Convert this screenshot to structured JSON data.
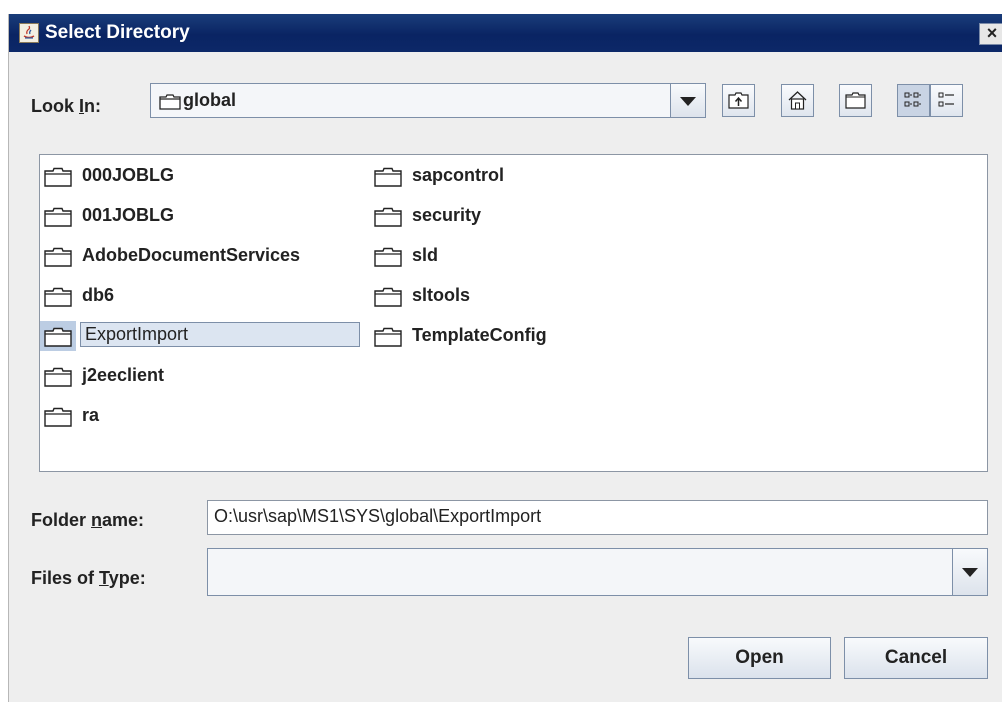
{
  "window": {
    "title": "Select Directory",
    "close_glyph": "×"
  },
  "look_in": {
    "label_pre": "Look ",
    "label_mnemonic": "I",
    "label_post": "n:",
    "value": "global"
  },
  "toolbar": {
    "buttons": [
      "up-one-level-icon",
      "home-icon",
      "new-folder-icon",
      "list-view-icon",
      "details-view-icon"
    ]
  },
  "files": {
    "column1": [
      "000JOBLG",
      "001JOBLG",
      "AdobeDocumentServices",
      "db6",
      "ExportImport",
      "j2eeclient",
      "ra"
    ],
    "column2": [
      "sapcontrol",
      "security",
      "sld",
      "sltools",
      "TemplateConfig"
    ],
    "selected": "ExportImport"
  },
  "folder_name": {
    "label_pre": "Folder ",
    "label_mnemonic": "n",
    "label_post": "ame:",
    "value": "O:\\usr\\sap\\MS1\\SYS\\global\\ExportImport"
  },
  "files_of_type": {
    "label_pre": "Files of ",
    "label_mnemonic": "T",
    "label_post": "ype:",
    "value": ""
  },
  "buttons": {
    "open": "Open",
    "cancel": "Cancel"
  },
  "colors": {
    "titlebar": "#0a2463",
    "selection": "#dce5f1",
    "background": "#eeeeee"
  }
}
